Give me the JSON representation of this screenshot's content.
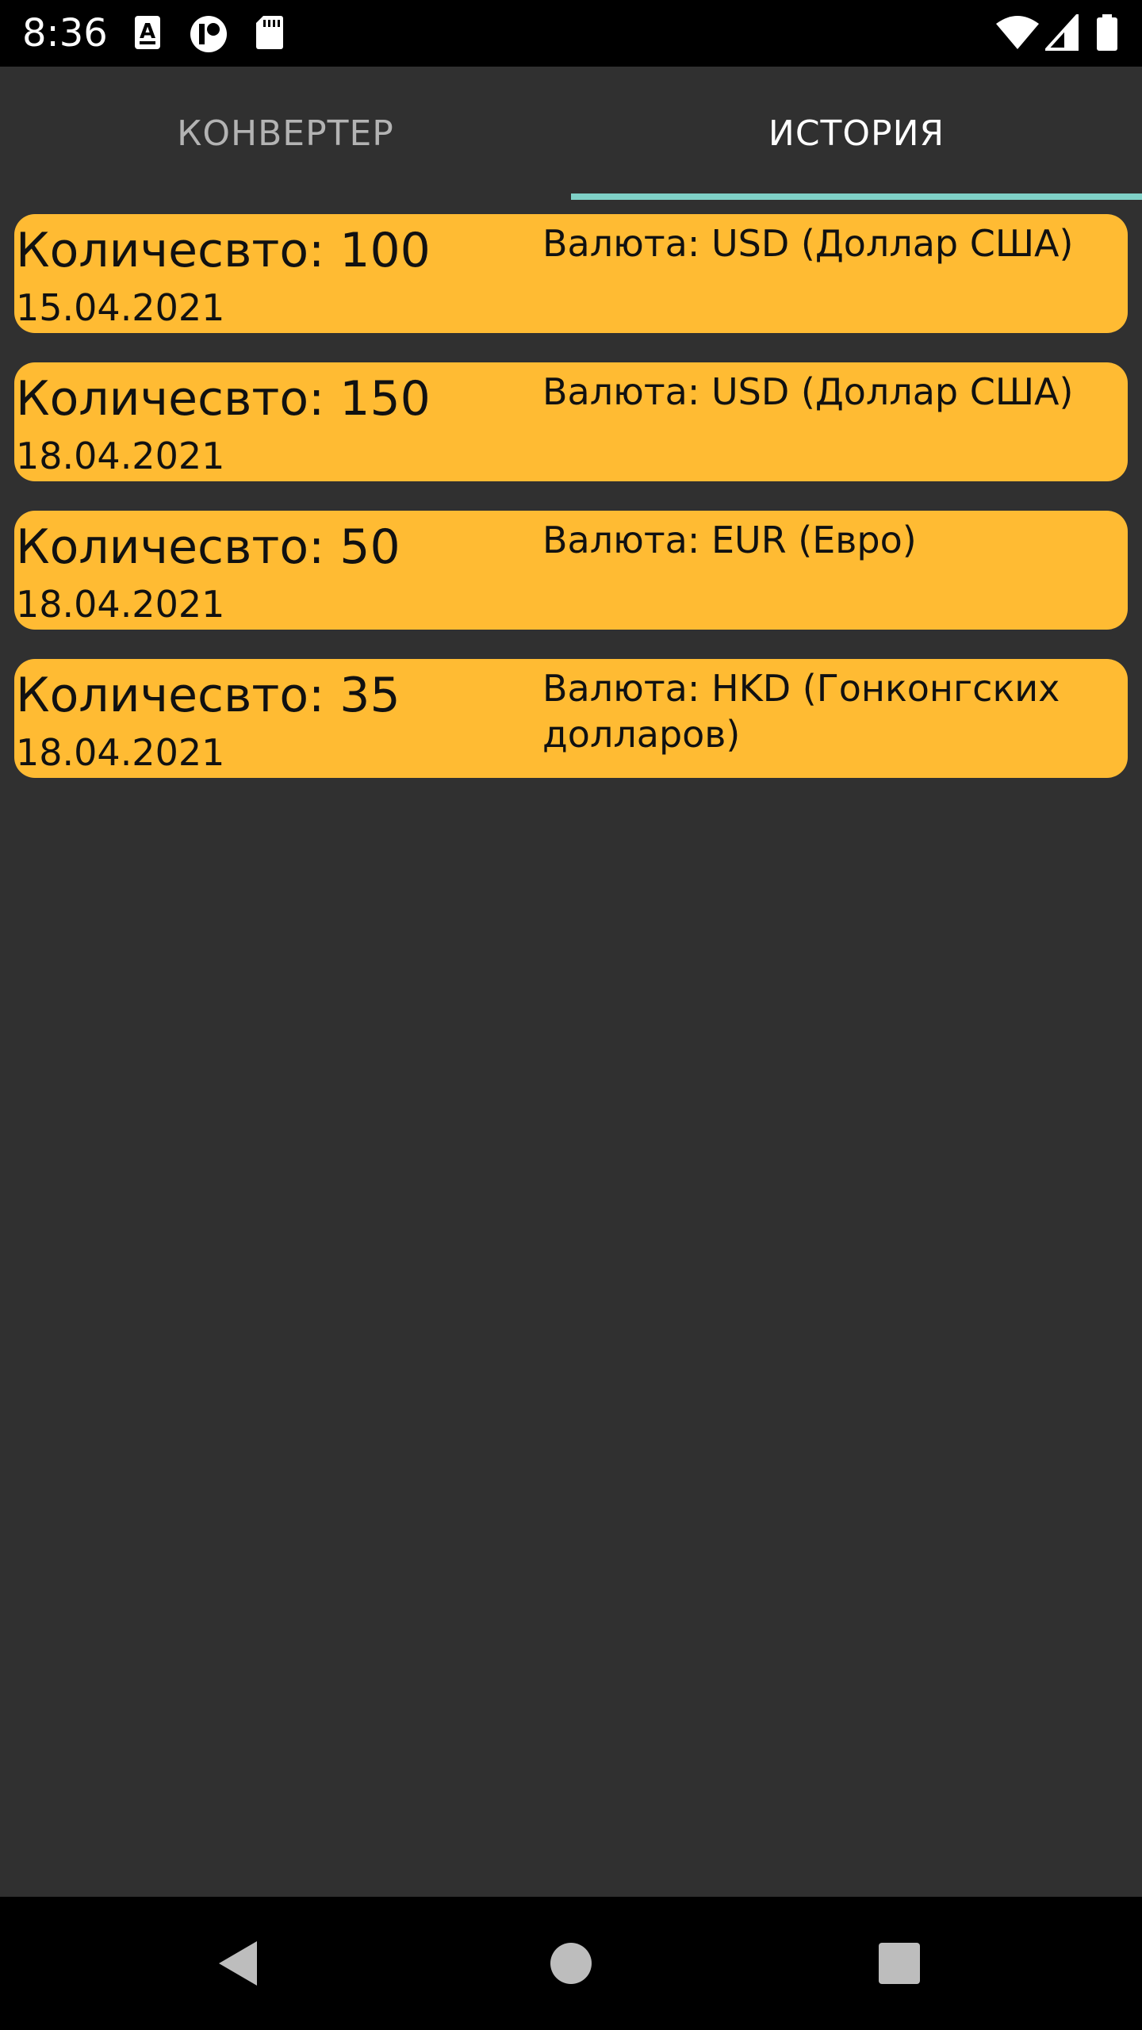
{
  "status_bar": {
    "time": "8:36",
    "icons": [
      "text-a-icon",
      "circle-app-icon",
      "sd-card-icon",
      "wifi-icon",
      "signal-icon",
      "battery-icon"
    ]
  },
  "tabs": [
    {
      "label": "КОНВЕРТЕР",
      "selected": false
    },
    {
      "label": "ИСТОРИЯ",
      "selected": true
    }
  ],
  "colors": {
    "background": "#303030",
    "card": "#ffbb33",
    "tab_indicator": "#7fd1c7",
    "status_bar": "#000000"
  },
  "history": [
    {
      "amount": "Количесвто: 100",
      "date": "15.04.2021",
      "currency": "Валюта: USD (Доллар США)"
    },
    {
      "amount": "Количесвто: 150",
      "date": "18.04.2021",
      "currency": "Валюта: USD (Доллар США)"
    },
    {
      "amount": "Количесвто: 50",
      "date": "18.04.2021",
      "currency": "Валюта: EUR (Евро)"
    },
    {
      "amount": "Количесвто: 35",
      "date": "18.04.2021",
      "currency": "Валюта: HKD (Гонконгских долларов)"
    }
  ],
  "nav_bar": {
    "icons": [
      "back-icon",
      "home-icon",
      "recents-icon"
    ]
  }
}
